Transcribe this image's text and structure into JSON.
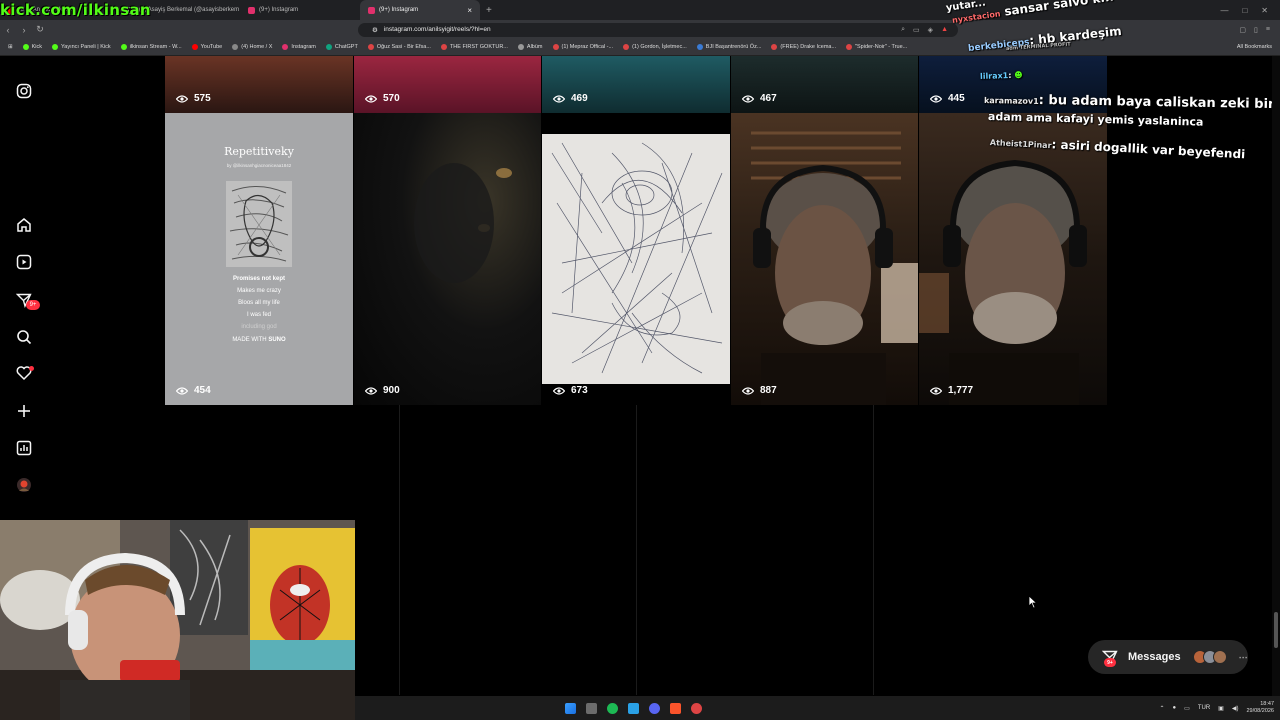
{
  "overlay": {
    "kick_url": "kick.com/ilkinsan"
  },
  "browser": {
    "tabs": [
      {
        "label": "to VI An Extended Lo",
        "active": false
      },
      {
        "label": "(2) Asayiş Berkemal (@asayisberkem",
        "active": false
      },
      {
        "label": "(9+) Instagram",
        "active": false
      },
      {
        "label": "(9+) Instagram",
        "active": true
      }
    ],
    "url": "instagram.com/anilsyigit/reels/?hl=en",
    "bookmarks": [
      "Kick",
      "Yayıncı Paneli | Kick",
      "ilkinsan Stream - W...",
      "YouTube",
      "(4) Home / X",
      "Instagram",
      "ChatGPT",
      "Oğuz Sasi - Bir Efsa...",
      "THE FIRST GOKTUR...",
      "Albüm",
      "(1) Mepraz Offical -...",
      "(1) Gordon, İşletmec...",
      "BJI Başantrenörü Öz...",
      "(FREE) Drake Icema...",
      "\"Spider-Noir\" - True..."
    ],
    "all_bookmarks": "All Bookmarks"
  },
  "sidebar": {
    "notifications_badge": "9+",
    "icons": [
      "instagram-icon",
      "home-icon",
      "reels-icon",
      "direct-icon",
      "search-icon",
      "heart-icon",
      "create-icon",
      "dashboard-icon",
      "profile-avatar"
    ]
  },
  "reels": {
    "top_row_views": [
      "575",
      "570",
      "469",
      "467",
      "445"
    ],
    "second_row_views": [
      "454",
      "900",
      "673",
      "887",
      "1,777"
    ],
    "suno_card": {
      "title": "Repetitiveky",
      "byline": "by @ilkinsanhgiacnoniceaa1842",
      "lines": [
        "Promises not kept",
        "Makes me crazy",
        "Bloos all my life",
        "I was fed",
        "including god"
      ],
      "made_with": "MADE WITH",
      "brand": "SUNO"
    }
  },
  "chat": [
    {
      "user": "",
      "text": "yutar..."
    },
    {
      "user": "nyxstacion",
      "text": "sansar salvo k..."
    },
    {
      "user": "berkebiceps",
      "text": "hb kardeşim"
    },
    {
      "user": "",
      "text": "adm TERMINAL PROFIT"
    },
    {
      "user": "lilrax1",
      "text": ""
    },
    {
      "user": "karamazov1",
      "text": "bu adam baya caliskan zeki bir"
    },
    {
      "user": "",
      "text": "adam ama kafayi yemis yaslaninca"
    },
    {
      "user": "Atheist1Pinar",
      "text": "asiri dogallik var beyefendi"
    }
  ],
  "messages": {
    "label": "Messages",
    "badge": "9+"
  },
  "taskbar": {
    "lang": "TUR",
    "time": "18:47",
    "date": "29/08/2026"
  },
  "colors": {
    "kick_green": "#53fc18",
    "ig_badge": "#ff3040",
    "bg": "#000000"
  }
}
